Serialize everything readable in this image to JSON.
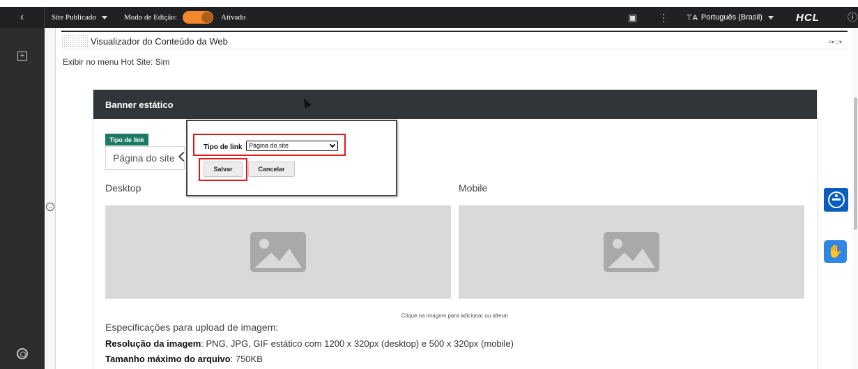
{
  "topbar": {
    "back_icon": "chevron-left",
    "site_status": "Site Publicado",
    "edit_mode_label": "Modo de Edição:",
    "edit_mode_state": "Ativado",
    "toggle_color": "#f0892e",
    "language": "Português (Brasil)",
    "brand": "HCL"
  },
  "portlet": {
    "title": "Visualizador do Conteúdo da Web",
    "hotsite_line": "Exibir no menu Hot Site: Sim"
  },
  "card": {
    "title": "Banner estático",
    "tipo_tag": "Tipo de link",
    "tipo_value": "Página do site",
    "desktop_label": "Desktop",
    "mobile_label": "Mobile",
    "hint": "Clique na imagem para adicionar ou alterar",
    "specs_title": "Especificações para upload de imagem:",
    "spec_resolution_label": "Resolução da imagem",
    "spec_resolution_value": ": PNG, JPG, GIF estático com 1200 x 320px (desktop) e 500 x 320px (mobile)",
    "spec_size_label": "Tamanho máximo do arquivo",
    "spec_size_value": ": 750KB"
  },
  "popup": {
    "label": "Tipo de link",
    "selected": "Página do site",
    "save": "Salvar",
    "cancel": "Cancelar",
    "highlight_color": "#e01b1b"
  },
  "colors": {
    "header_dark": "#2f3538",
    "tag_green": "#1b7a66",
    "accessibility_blue": "#0b5cbf"
  }
}
